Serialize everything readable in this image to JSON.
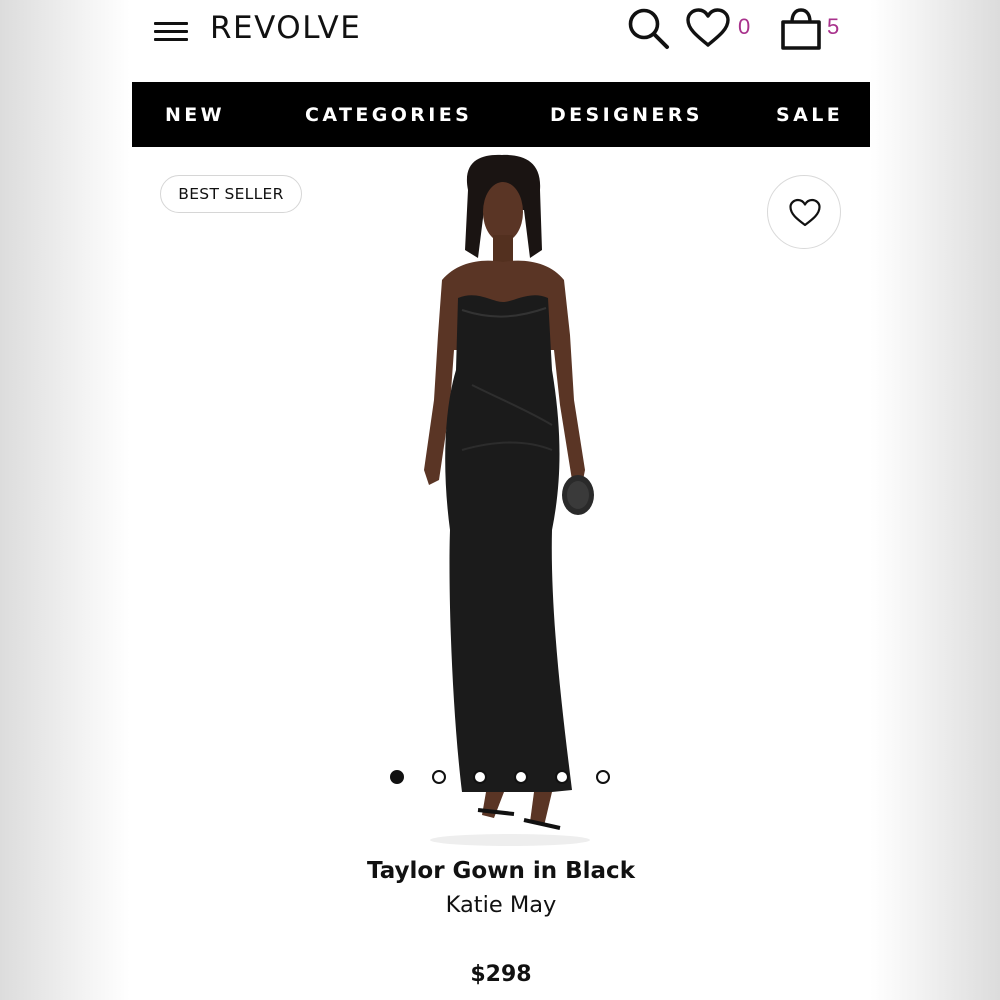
{
  "header": {
    "logo": "REVOLVE",
    "wishlist_count": "0",
    "bag_count": "5",
    "accent_color": "#a8328c",
    "icons": [
      "menu-icon",
      "search-icon",
      "heart-icon",
      "shopping-bag-icon"
    ]
  },
  "nav": {
    "items": [
      "NEW",
      "CATEGORIES",
      "DESIGNERS",
      "SALE"
    ]
  },
  "product": {
    "badge": "BEST SELLER",
    "title": "Taylor Gown in Black",
    "brand": "Katie May",
    "price": "$298",
    "image_count": 6,
    "active_image": 1
  }
}
